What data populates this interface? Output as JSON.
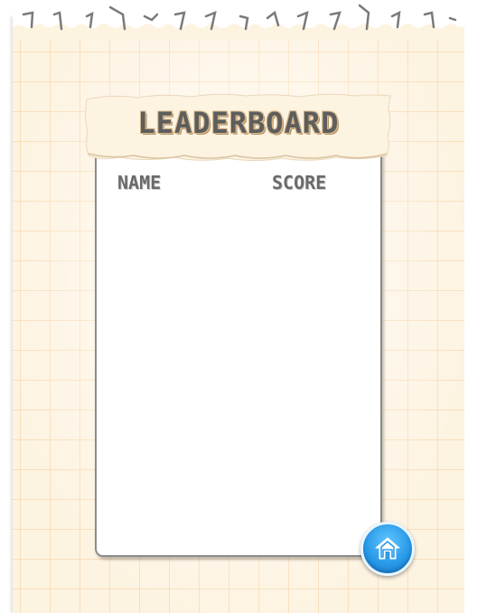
{
  "leaderboard": {
    "title": "LEADERBOARD",
    "columns": {
      "name": "NAME",
      "score": "SCORE"
    },
    "entries": []
  },
  "controls": {
    "home_icon": "home-icon"
  },
  "colors": {
    "paper": "#fdf3e1",
    "grid_lines": "#f3c88c",
    "title_text": "#5d5d5d",
    "header_text": "#6a6a6a",
    "home_button": "#2a9be8"
  }
}
